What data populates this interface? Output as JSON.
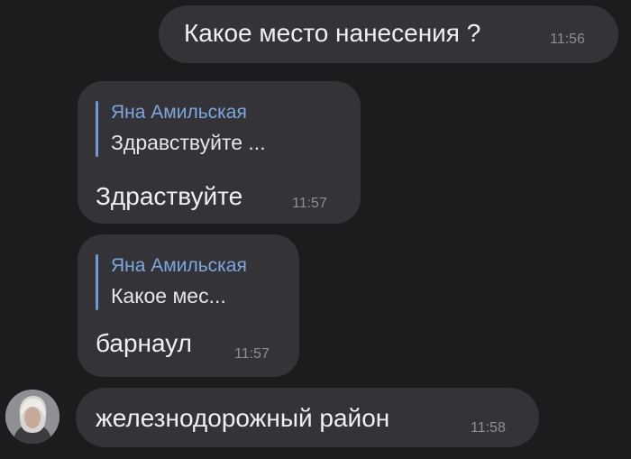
{
  "messages": [
    {
      "text": "Какое место нанесения ?",
      "time": "11:56"
    },
    {
      "reply": {
        "author": "Яна Амильская",
        "snippet": "Здравствуйте ..."
      },
      "text": "Здраствуйте",
      "time": "11:57"
    },
    {
      "reply": {
        "author": "Яна Амильская",
        "snippet": "Какое мес..."
      },
      "text": "барнаул",
      "time": "11:57"
    },
    {
      "text": "железнодорожный район",
      "time": "11:58"
    }
  ],
  "colors": {
    "background": "#1c1c1e",
    "bubble": "#333338",
    "quote_accent": "#6d9bd6",
    "timestamp": "#8e8e93"
  },
  "icons": {
    "avatar": "user-avatar-photo"
  }
}
